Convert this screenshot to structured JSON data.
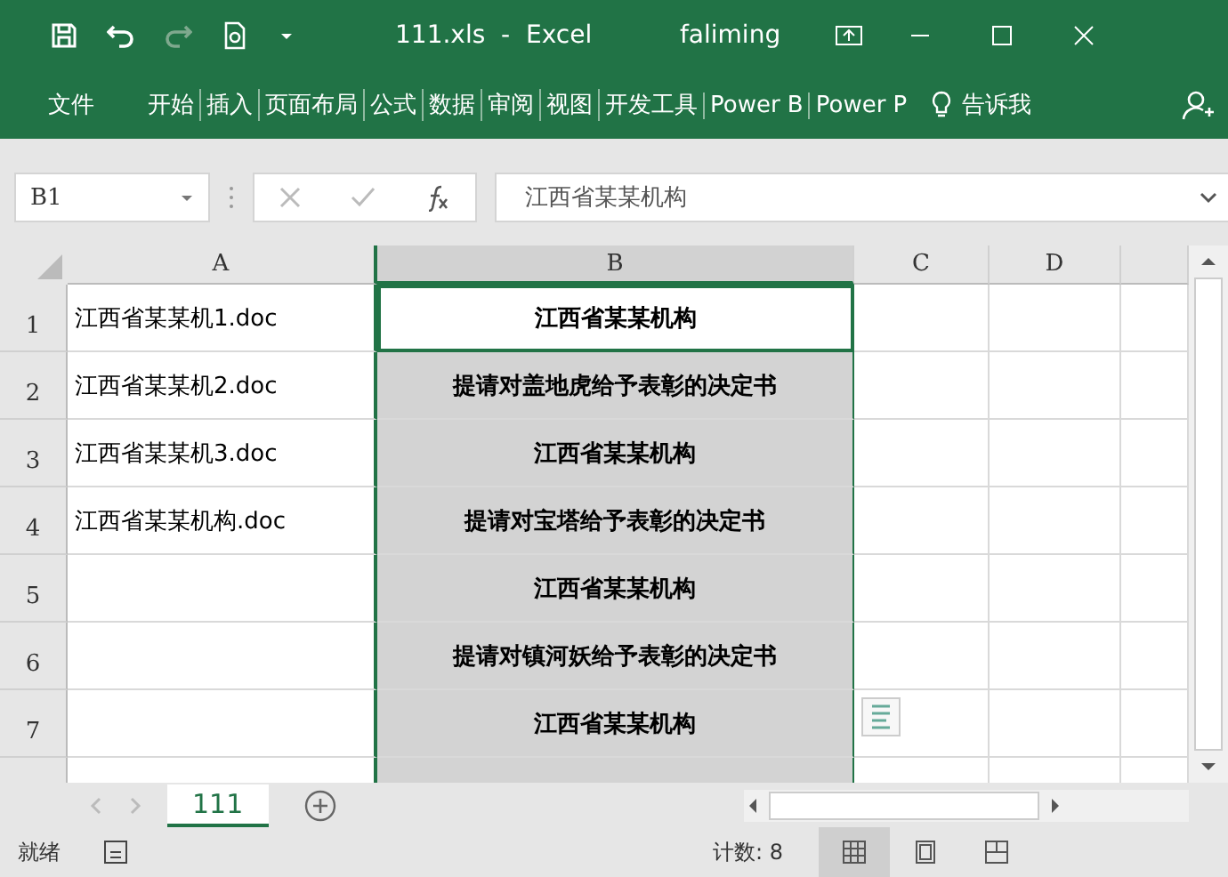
{
  "window": {
    "title": "111.xls  -  Excel",
    "user": "faliming"
  },
  "ribbon_tabs": [
    {
      "label": "文件"
    },
    {
      "label": "开始"
    },
    {
      "label": "插入"
    },
    {
      "label": "页面布局"
    },
    {
      "label": "公式"
    },
    {
      "label": "数据"
    },
    {
      "label": "审阅"
    },
    {
      "label": "视图"
    },
    {
      "label": "开发工具"
    },
    {
      "label": "Power B"
    },
    {
      "label": "Power P"
    }
  ],
  "tell_me": "告诉我",
  "formula_bar": {
    "name_box": "B1",
    "value": "江西省某某机构"
  },
  "columns": [
    {
      "label": "A",
      "selected": false
    },
    {
      "label": "B",
      "selected": true
    },
    {
      "label": "C",
      "selected": false
    },
    {
      "label": "D",
      "selected": false
    }
  ],
  "rows": [
    {
      "header": "1",
      "a": "江西省某某机1.doc",
      "b": "江西省某某机构",
      "active": true
    },
    {
      "header": "2",
      "a": "江西省某某机2.doc",
      "b": "提请对盖地虎给予表彰的决定书",
      "active": false
    },
    {
      "header": "3",
      "a": "江西省某某机3.doc",
      "b": "江西省某某机构",
      "active": false
    },
    {
      "header": "4",
      "a": "江西省某某机构.doc",
      "b": "提请对宝塔给予表彰的决定书",
      "active": false
    },
    {
      "header": "5",
      "a": "",
      "b": "江西省某某机构",
      "active": false
    },
    {
      "header": "6",
      "a": "",
      "b": "提请对镇河妖给予表彰的决定书",
      "active": false
    },
    {
      "header": "7",
      "a": "",
      "b": "江西省某某机构",
      "active": false
    }
  ],
  "sheet_tabs": [
    {
      "label": "111",
      "selected": true
    }
  ],
  "status_bar": {
    "mode": "就绪",
    "count": "计数: 8"
  }
}
